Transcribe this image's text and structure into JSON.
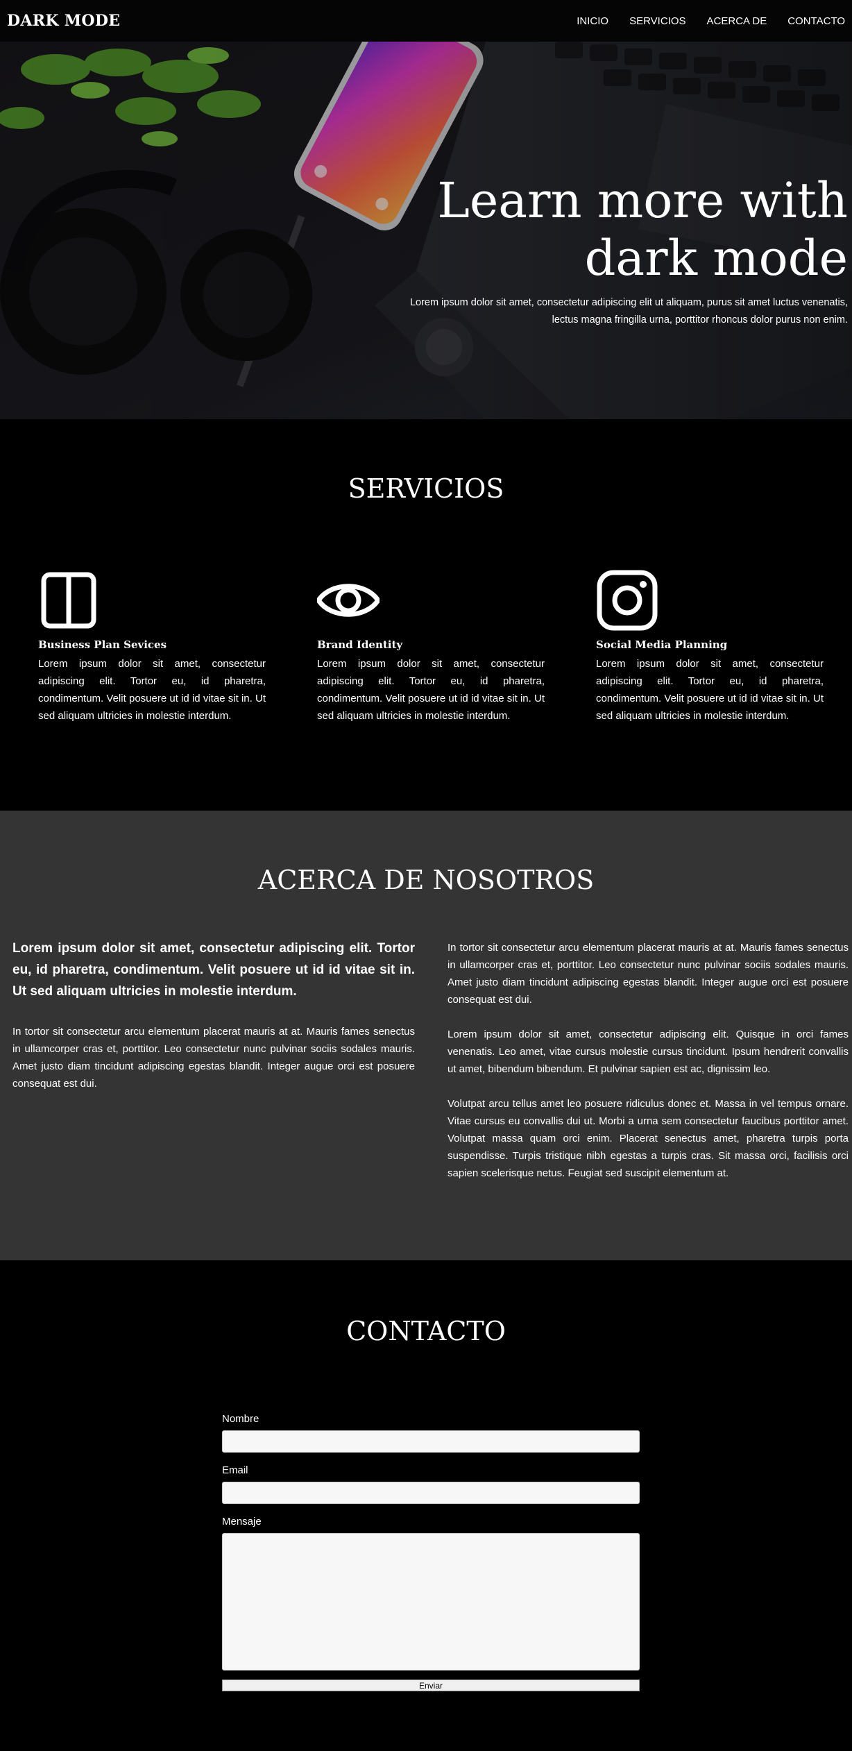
{
  "nav": {
    "brand": "DARK MODE",
    "links": [
      "INICIO",
      "SERVICIOS",
      "ACERCA DE",
      "CONTACTO"
    ]
  },
  "hero": {
    "title_line1": "Learn more with",
    "title_line2": "dark mode",
    "subtitle": "Lorem ipsum dolor sit amet, consectetur adipiscing elit ut aliquam, purus sit amet luctus venenatis, lectus magna fringilla urna, porttitor rhoncus dolor purus non enim."
  },
  "servicios": {
    "title": "SERVICIOS",
    "items": [
      {
        "icon": "columns-icon",
        "title": "Business Plan Sevices",
        "text": "Lorem ipsum dolor sit amet, consectetur adipiscing elit. Tortor eu, id pharetra, condimentum. Velit posuere ut id id vitae sit in. Ut sed aliquam ultricies in molestie interdum."
      },
      {
        "icon": "eye-icon",
        "title": "Brand Identity",
        "text": "Lorem ipsum dolor sit amet, consectetur adipiscing elit. Tortor eu, id pharetra, condimentum. Velit posuere ut id id vitae sit in. Ut sed aliquam ultricies in molestie interdum."
      },
      {
        "icon": "instagram-icon",
        "title": "Social Media Planning",
        "text": "Lorem ipsum dolor sit amet, consectetur adipiscing elit. Tortor eu, id pharetra, condimentum. Velit posuere ut id id vitae sit in. Ut sed aliquam ultricies in molestie interdum."
      }
    ]
  },
  "acerca": {
    "title": "ACERCA DE NOSOTROS",
    "lead": "Lorem ipsum dolor sit amet, consectetur adipiscing elit. Tortor eu, id pharetra, condimentum. Velit posuere ut id id vitae sit in. Ut sed aliquam ultricies in molestie interdum.",
    "left_p": "In tortor sit consectetur arcu elementum placerat mauris at at. Mauris fames senectus in ullamcorper cras et, porttitor. Leo consectetur nunc pulvinar sociis sodales mauris. Amet justo diam tincidunt adipiscing egestas blandit. Integer augue orci est posuere consequat est dui.",
    "right_p1": "In tortor sit consectetur arcu elementum placerat mauris at at. Mauris fames senectus in ullamcorper cras et, porttitor. Leo consectetur nunc pulvinar sociis sodales mauris. Amet justo diam tincidunt adipiscing egestas blandit. Integer augue orci est posuere consequat est dui.",
    "right_p2": "Lorem ipsum dolor sit amet, consectetur adipiscing elit. Quisque in orci fames venenatis. Leo amet, vitae cursus molestie cursus tincidunt. Ipsum hendrerit convallis ut amet, bibendum bibendum. Et pulvinar sapien est ac, dignissim leo.",
    "right_p3": "Volutpat arcu tellus amet leo posuere ridiculus donec et. Massa in vel tempus ornare. Vitae cursus eu convallis dui ut. Morbi a urna sem consectetur faucibus porttitor amet. Volutpat massa quam orci enim. Placerat senectus amet, pharetra turpis porta suspendisse. Turpis tristique nibh egestas a turpis cras. Sit massa orci, facilisis orci sapien scelerisque netus. Feugiat sed suscipit elementum at."
  },
  "contacto": {
    "title": "CONTACTO",
    "name_label": "Nombre",
    "email_label": "Email",
    "message_label": "Mensaje",
    "submit_label": "Enviar"
  }
}
